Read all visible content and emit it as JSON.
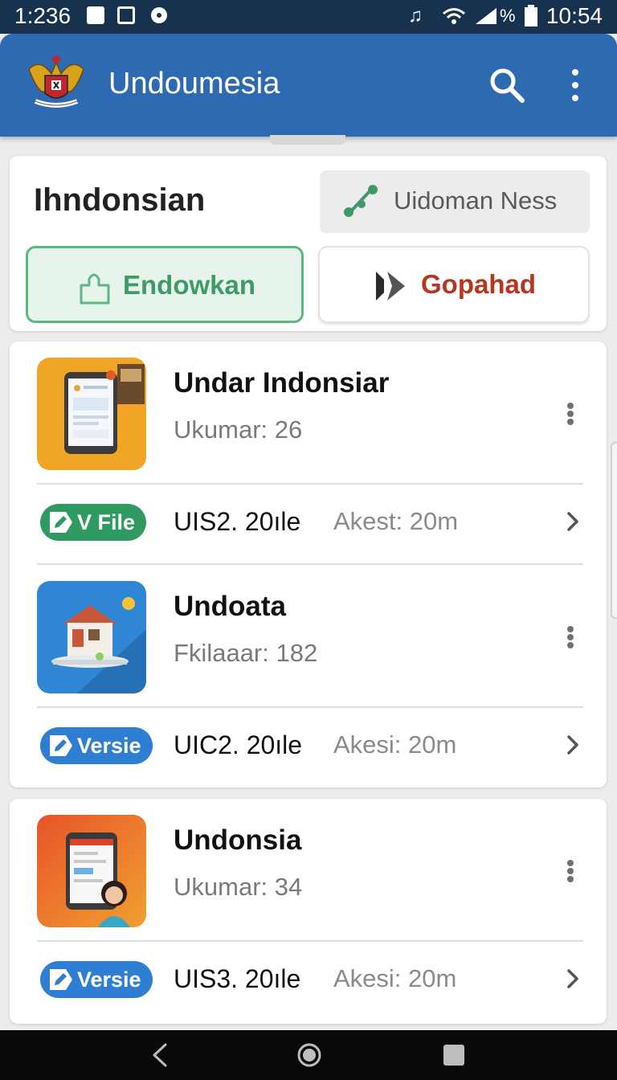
{
  "status_bar": {
    "time_left": "1:236",
    "time_right": "10:54",
    "battery_label": "%"
  },
  "app_bar": {
    "title": "Undoumesia",
    "search_icon": "search-icon",
    "more_icon": "more-vert-icon"
  },
  "header": {
    "title": "Ihndonsian",
    "guide_button": "Uidoman Ness",
    "download_button": "Endowkan",
    "go_button": "Gopahad"
  },
  "items": [
    {
      "title": "Undar Indonsiar",
      "subtitle": "Ukumar: 26",
      "badge": "V File",
      "version": "UIS2. 20ıle",
      "access": "Akest: 20m"
    },
    {
      "title": "Undoata",
      "subtitle": "Fkilaaar: 182",
      "badge": "Versie",
      "version": "UIC2. 20ıle",
      "access": "Akesi: 20m"
    },
    {
      "title": "Undonsia",
      "subtitle": "Ukumar: 34",
      "badge": "Versie",
      "version": "UIS3. 20ıle",
      "access": "Akesi: 20m"
    }
  ],
  "colors": {
    "status_bar": "#17324f",
    "app_bar": "#2d6ab2",
    "download_accent": "#3e9a67",
    "go_accent": "#b8361f",
    "badge_green": "#2f9b62",
    "badge_blue": "#2e7fd3"
  }
}
